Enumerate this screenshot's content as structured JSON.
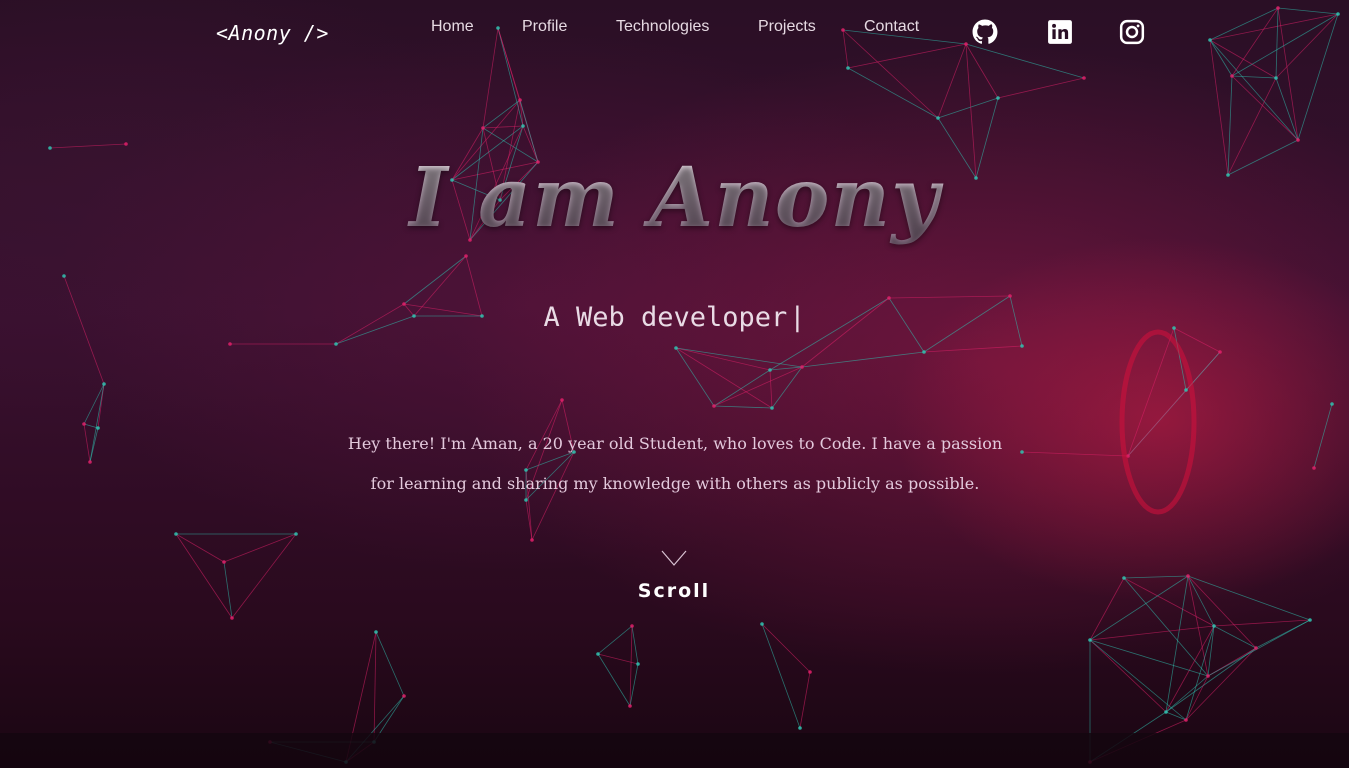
{
  "navbar": {
    "brand": "<Anony />",
    "links": [
      {
        "label": "Home"
      },
      {
        "label": "Profile"
      },
      {
        "label": "Technologies"
      },
      {
        "label": "Projects"
      },
      {
        "label": "Contact"
      }
    ],
    "social": [
      {
        "icon": "github-icon"
      },
      {
        "icon": "linkedin-icon"
      },
      {
        "icon": "instagram-icon"
      }
    ]
  },
  "hero": {
    "title": "I am Anony",
    "role_prefix": "A",
    "role_text": "Web developer",
    "cursor": "|",
    "intro": "Hey there! I'm Aman, a 20 year old Student, who loves to Code. I have a passion for learning and sharing my knowledge with others as publicly as possible.",
    "scroll_label": "Scroll",
    "scroll_icon": "chevron-down-icon"
  },
  "colors": {
    "accent_pink": "#e0206a",
    "accent_teal": "#2fc4b2",
    "text": "#e6d9e2"
  }
}
